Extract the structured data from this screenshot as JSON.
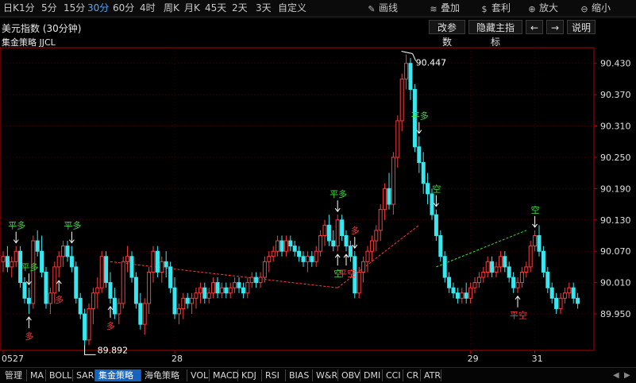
{
  "toolbar": {
    "periods": [
      {
        "label": "日K",
        "active": false
      },
      {
        "label": "1分",
        "active": false
      },
      {
        "label": "5分",
        "active": false
      },
      {
        "label": "15分",
        "active": false
      },
      {
        "label": "30分",
        "active": true
      },
      {
        "label": "60分",
        "active": false
      },
      {
        "label": "4时",
        "active": false
      },
      {
        "label": "周K",
        "active": false
      },
      {
        "label": "月K",
        "active": false
      },
      {
        "label": "45天",
        "active": false
      },
      {
        "label": "2天",
        "active": false
      },
      {
        "label": "3天",
        "active": false
      },
      {
        "label": "自定义",
        "active": false
      }
    ],
    "tools": [
      {
        "label": "画线",
        "icon": "draw-line-icon"
      },
      {
        "label": "叠加",
        "icon": "overlay-stack-icon"
      },
      {
        "label": "套利",
        "icon": "arbitrage-bag-icon"
      },
      {
        "label": "放大",
        "icon": "zoom-in-icon"
      },
      {
        "label": "缩小",
        "icon": "zoom-out-icon"
      }
    ]
  },
  "header": {
    "title": "美元指数 (30分钟)",
    "indicator": "集金策略 JJCL",
    "buttons": {
      "edit_params": "改参数",
      "hide_main": "隐藏主指标",
      "left_arrow": "←",
      "right_arrow": "→",
      "help": "说明"
    }
  },
  "colors": {
    "background": "#000000",
    "up": "#ff3b3b",
    "down": "#38e8f0",
    "flat_signal": "#3ce03c",
    "short_signal": "#3ce03c",
    "long_signal": "#ff3b3b",
    "grid": "#3a0000",
    "axis": "#b30000"
  },
  "chart_data": {
    "type": "candlestick",
    "y_axis": {
      "ticks": [
        "90.430",
        "90.370",
        "90.310",
        "90.250",
        "90.190",
        "90.130",
        "90.070",
        "90.010",
        "89.950"
      ],
      "range": [
        89.88,
        90.46
      ]
    },
    "x_axis": {
      "date_labels": [
        {
          "label": "0527",
          "index": 0
        },
        {
          "label": "28",
          "index": 40
        },
        {
          "label": "29",
          "index": 109
        },
        {
          "label": "31",
          "index": 124
        }
      ]
    },
    "annotations": {
      "high": "90.447",
      "low": "89.892"
    },
    "candles": [
      [
        90.05,
        90.07,
        90.03,
        90.06
      ],
      [
        90.06,
        90.08,
        90.03,
        90.04
      ],
      [
        90.04,
        90.06,
        90.02,
        90.05
      ],
      [
        90.05,
        90.08,
        90.04,
        90.07
      ],
      [
        90.07,
        90.08,
        90.0,
        90.01
      ],
      [
        90.01,
        90.02,
        89.97,
        89.98
      ],
      [
        89.98,
        90.0,
        89.95,
        89.97
      ],
      [
        89.97,
        90.1,
        89.96,
        90.09
      ],
      [
        90.09,
        90.11,
        90.06,
        90.07
      ],
      [
        90.07,
        90.1,
        90.02,
        90.03
      ],
      [
        90.03,
        90.04,
        89.96,
        89.97
      ],
      [
        89.97,
        90.0,
        89.95,
        89.99
      ],
      [
        89.99,
        90.05,
        89.97,
        90.04
      ],
      [
        90.04,
        90.07,
        90.02,
        90.06
      ],
      [
        90.06,
        90.09,
        90.04,
        90.08
      ],
      [
        90.08,
        90.09,
        90.05,
        90.06
      ],
      [
        90.06,
        90.08,
        90.03,
        90.04
      ],
      [
        90.04,
        90.05,
        89.97,
        89.98
      ],
      [
        89.98,
        89.99,
        89.94,
        89.95
      ],
      [
        89.95,
        89.96,
        89.89,
        89.9
      ],
      [
        89.9,
        89.97,
        89.89,
        89.96
      ],
      [
        89.96,
        90.0,
        89.93,
        89.99
      ],
      [
        89.99,
        90.02,
        89.96,
        90.0
      ],
      [
        90.0,
        90.07,
        89.99,
        90.06
      ],
      [
        90.06,
        90.07,
        90.0,
        90.01
      ],
      [
        90.01,
        90.03,
        89.97,
        89.98
      ],
      [
        89.98,
        90.0,
        89.94,
        89.95
      ],
      [
        89.95,
        89.98,
        89.93,
        89.97
      ],
      [
        89.97,
        90.06,
        89.96,
        90.05
      ],
      [
        90.05,
        90.08,
        90.03,
        90.06
      ],
      [
        90.06,
        90.07,
        90.01,
        90.02
      ],
      [
        90.02,
        90.03,
        89.96,
        89.97
      ],
      [
        89.97,
        89.99,
        89.92,
        89.93
      ],
      [
        89.93,
        89.98,
        89.91,
        89.97
      ],
      [
        89.97,
        90.04,
        89.95,
        90.03
      ],
      [
        90.03,
        90.08,
        90.01,
        90.07
      ],
      [
        90.07,
        90.08,
        90.02,
        90.03
      ],
      [
        90.03,
        90.06,
        90.01,
        90.05
      ],
      [
        90.05,
        90.07,
        90.02,
        90.04
      ],
      [
        90.04,
        90.05,
        89.99,
        90.0
      ],
      [
        90.0,
        90.02,
        89.94,
        89.95
      ],
      [
        89.95,
        89.97,
        89.93,
        89.96
      ],
      [
        89.96,
        89.99,
        89.94,
        89.98
      ],
      [
        89.98,
        89.99,
        89.96,
        89.97
      ],
      [
        89.97,
        89.99,
        89.95,
        89.98
      ],
      [
        89.98,
        90.0,
        89.96,
        89.99
      ],
      [
        89.99,
        90.01,
        89.97,
        90.0
      ],
      [
        90.0,
        90.01,
        89.97,
        89.98
      ],
      [
        89.98,
        90.0,
        89.97,
        89.99
      ],
      [
        89.99,
        90.02,
        89.98,
        90.01
      ],
      [
        90.01,
        90.02,
        89.98,
        89.99
      ],
      [
        89.99,
        90.01,
        89.98,
        90.0
      ],
      [
        90.0,
        90.01,
        89.98,
        89.99
      ],
      [
        89.99,
        90.01,
        89.98,
        90.0
      ],
      [
        90.0,
        90.02,
        89.99,
        90.01
      ],
      [
        90.01,
        90.02,
        89.99,
        90.0
      ],
      [
        90.0,
        90.01,
        89.98,
        89.99
      ],
      [
        89.99,
        90.02,
        89.98,
        90.01
      ],
      [
        90.01,
        90.03,
        90.0,
        90.02
      ],
      [
        90.02,
        90.03,
        90.0,
        90.01
      ],
      [
        90.01,
        90.03,
        90.0,
        90.02
      ],
      [
        90.02,
        90.06,
        90.01,
        90.05
      ],
      [
        90.05,
        90.07,
        90.03,
        90.06
      ],
      [
        90.06,
        90.08,
        90.05,
        90.07
      ],
      [
        90.07,
        90.1,
        90.06,
        90.09
      ],
      [
        90.09,
        90.1,
        90.06,
        90.07
      ],
      [
        90.07,
        90.1,
        90.06,
        90.09
      ],
      [
        90.09,
        90.1,
        90.07,
        90.08
      ],
      [
        90.08,
        90.09,
        90.06,
        90.07
      ],
      [
        90.07,
        90.08,
        90.05,
        90.06
      ],
      [
        90.06,
        90.07,
        90.04,
        90.05
      ],
      [
        90.05,
        90.07,
        90.03,
        90.06
      ],
      [
        90.06,
        90.07,
        90.04,
        90.05
      ],
      [
        90.05,
        90.08,
        90.04,
        90.07
      ],
      [
        90.07,
        90.11,
        90.06,
        90.1
      ],
      [
        90.1,
        90.13,
        90.08,
        90.12
      ],
      [
        90.12,
        90.14,
        90.08,
        90.09
      ],
      [
        90.09,
        90.11,
        90.07,
        90.08
      ],
      [
        90.08,
        90.14,
        90.07,
        90.13
      ],
      [
        90.13,
        90.14,
        90.09,
        90.1
      ],
      [
        90.1,
        90.11,
        90.07,
        90.08
      ],
      [
        90.08,
        90.09,
        90.05,
        90.06
      ],
      [
        90.06,
        90.07,
        89.98,
        89.99
      ],
      [
        89.99,
        90.04,
        89.98,
        90.03
      ],
      [
        90.03,
        90.06,
        90.01,
        90.05
      ],
      [
        90.05,
        90.08,
        90.03,
        90.07
      ],
      [
        90.07,
        90.1,
        90.05,
        90.09
      ],
      [
        90.09,
        90.12,
        90.07,
        90.11
      ],
      [
        90.11,
        90.16,
        90.09,
        90.15
      ],
      [
        90.15,
        90.2,
        90.13,
        90.19
      ],
      [
        90.19,
        90.22,
        90.15,
        90.16
      ],
      [
        90.16,
        90.26,
        90.14,
        90.25
      ],
      [
        90.25,
        90.33,
        90.23,
        90.32
      ],
      [
        90.32,
        90.41,
        90.3,
        90.4
      ],
      [
        90.4,
        90.447,
        90.38,
        90.43
      ],
      [
        90.43,
        90.44,
        90.36,
        90.38
      ],
      [
        90.38,
        90.39,
        90.26,
        90.27
      ],
      [
        90.27,
        90.29,
        90.22,
        90.24
      ],
      [
        90.24,
        90.26,
        90.18,
        90.2
      ],
      [
        90.2,
        90.22,
        90.16,
        90.18
      ],
      [
        90.18,
        90.19,
        90.13,
        90.14
      ],
      [
        90.14,
        90.15,
        90.09,
        90.1
      ],
      [
        90.1,
        90.11,
        90.05,
        90.06
      ],
      [
        90.06,
        90.07,
        90.01,
        90.02
      ],
      [
        90.02,
        90.03,
        89.99,
        90.0
      ],
      [
        90.0,
        90.01,
        89.98,
        89.99
      ],
      [
        89.99,
        90.0,
        89.97,
        89.98
      ],
      [
        89.98,
        90.0,
        89.97,
        89.99
      ],
      [
        89.99,
        90.01,
        89.97,
        89.98
      ],
      [
        89.98,
        90.01,
        89.97,
        90.0
      ],
      [
        90.0,
        90.02,
        89.99,
        90.01
      ],
      [
        90.01,
        90.03,
        90.0,
        90.02
      ],
      [
        90.02,
        90.04,
        90.01,
        90.03
      ],
      [
        90.03,
        90.06,
        90.02,
        90.05
      ],
      [
        90.05,
        90.06,
        90.02,
        90.03
      ],
      [
        90.03,
        90.05,
        90.02,
        90.04
      ],
      [
        90.04,
        90.07,
        90.03,
        90.06
      ],
      [
        90.06,
        90.07,
        90.03,
        90.04
      ],
      [
        90.04,
        90.05,
        90.01,
        90.02
      ],
      [
        90.02,
        90.03,
        89.99,
        90.0
      ],
      [
        90.0,
        90.02,
        89.99,
        90.01
      ],
      [
        90.01,
        90.04,
        90.0,
        90.03
      ],
      [
        90.03,
        90.05,
        90.02,
        90.04
      ],
      [
        90.04,
        90.09,
        90.03,
        90.08
      ],
      [
        90.08,
        90.11,
        90.07,
        90.1
      ],
      [
        90.1,
        90.12,
        90.06,
        90.07
      ],
      [
        90.07,
        90.08,
        90.02,
        90.03
      ],
      [
        90.03,
        90.04,
        89.99,
        90.0
      ],
      [
        90.0,
        90.01,
        89.97,
        89.98
      ],
      [
        89.98,
        89.99,
        89.95,
        89.96
      ],
      [
        89.96,
        89.99,
        89.95,
        89.98
      ],
      [
        89.98,
        90.0,
        89.97,
        89.99
      ],
      [
        89.99,
        90.01,
        89.98,
        90.0
      ],
      [
        90.0,
        90.01,
        89.97,
        89.98
      ],
      [
        89.98,
        89.99,
        89.96,
        89.97
      ]
    ],
    "signals": [
      {
        "index": 3,
        "label": "平多",
        "kind": "flat",
        "pos": "above"
      },
      {
        "index": 6,
        "label": "平多",
        "kind": "flat",
        "pos": "above"
      },
      {
        "index": 6,
        "label": "多",
        "kind": "long",
        "pos": "below"
      },
      {
        "index": 13,
        "label": "多",
        "kind": "long",
        "pos": "below"
      },
      {
        "index": 16,
        "label": "平多",
        "kind": "flat",
        "pos": "above"
      },
      {
        "index": 25,
        "label": "多",
        "kind": "long",
        "pos": "below"
      },
      {
        "index": 78,
        "label": "平多",
        "kind": "flat",
        "pos": "above"
      },
      {
        "index": 78,
        "label": "空",
        "kind": "short",
        "pos": "below"
      },
      {
        "index": 80,
        "label": "平空",
        "kind": "long",
        "pos": "below"
      },
      {
        "index": 82,
        "label": "多",
        "kind": "long",
        "pos": "above"
      },
      {
        "index": 97,
        "label": "平多",
        "kind": "flat",
        "pos": "above"
      },
      {
        "index": 101,
        "label": "空",
        "kind": "short",
        "pos": "above"
      },
      {
        "index": 120,
        "label": "平空",
        "kind": "long",
        "pos": "below"
      },
      {
        "index": 124,
        "label": "空",
        "kind": "short",
        "pos": "above"
      }
    ],
    "trend_lines": [
      {
        "from": [
          25,
          90.05
        ],
        "to": [
          78,
          90.0
        ],
        "color": "red"
      },
      {
        "from": [
          78,
          90.0
        ],
        "to": [
          97,
          90.12
        ],
        "color": "red"
      },
      {
        "from": [
          101,
          90.04
        ],
        "to": [
          122,
          90.11
        ],
        "color": "green"
      }
    ]
  },
  "tabs": {
    "items": [
      {
        "label": "管理",
        "active": false
      },
      {
        "label": "MA",
        "active": false
      },
      {
        "label": "BOLL",
        "active": false
      },
      {
        "label": "SAR",
        "active": false
      },
      {
        "label": "集金策略",
        "active": true
      },
      {
        "label": "海龟策略",
        "active": false
      },
      {
        "label": "VOL",
        "active": false
      },
      {
        "label": "MACD",
        "active": false
      },
      {
        "label": "KDJ",
        "active": false
      },
      {
        "label": "RSI",
        "active": false
      },
      {
        "label": "BIAS",
        "active": false
      },
      {
        "label": "W&R",
        "active": false
      },
      {
        "label": "OBV",
        "active": false
      },
      {
        "label": "DMI",
        "active": false
      },
      {
        "label": "CCI",
        "active": false
      },
      {
        "label": "CR",
        "active": false
      },
      {
        "label": "ATR",
        "active": false
      }
    ]
  }
}
